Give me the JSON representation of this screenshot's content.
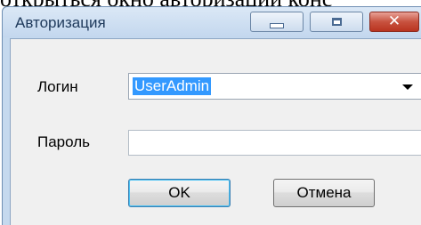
{
  "background_text": "открыться окно авторизации конс",
  "window": {
    "title": "Авторизация",
    "controls": {
      "minimize_icon": "minimize-icon",
      "maximize_icon": "maximize-icon",
      "close_icon": "close-icon",
      "close_glyph": "✕"
    }
  },
  "form": {
    "login_label": "Логин",
    "login_value": "UserAdmin",
    "password_label": "Пароль",
    "password_value": ""
  },
  "buttons": {
    "ok_label": "OK",
    "cancel_label": "Отмена"
  },
  "colors": {
    "selection": "#3399ff",
    "close_button": "#c8523f",
    "titlebar": "#c5d9ee"
  }
}
